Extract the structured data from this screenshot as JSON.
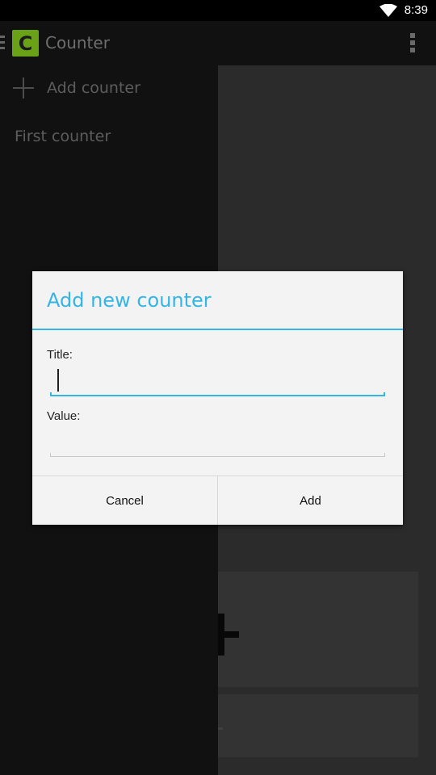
{
  "status_bar": {
    "time": "8:39"
  },
  "action_bar": {
    "logo_letter": "C",
    "title": "Counter"
  },
  "drawer": {
    "add_label": "Add counter",
    "items": [
      {
        "label": "First counter"
      }
    ]
  },
  "dialog": {
    "title": "Add new counter",
    "title_field": {
      "label": "Title:",
      "value": ""
    },
    "value_field": {
      "label": "Value:",
      "value": ""
    },
    "cancel_label": "Cancel",
    "add_label": "Add"
  },
  "colors": {
    "accent": "#33b5e5",
    "logo": "#6aa217",
    "dialog_bg": "#f3f3f3"
  },
  "icons": [
    "wifi-icon",
    "battery-icon",
    "drawer-indicator-icon",
    "app-logo-icon",
    "overflow-menu-icon",
    "plus-icon"
  ]
}
